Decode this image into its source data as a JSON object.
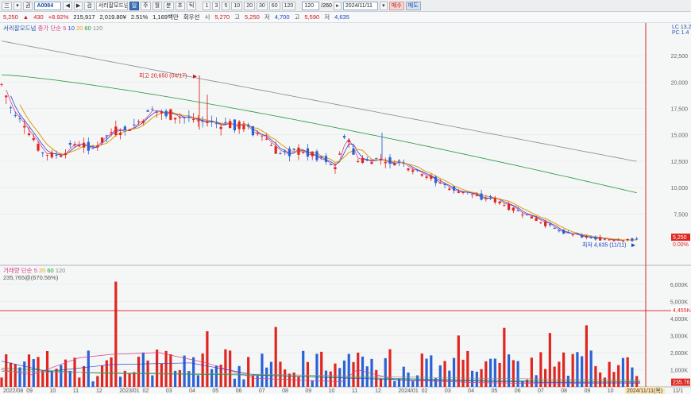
{
  "toolbar": {
    "buttons_left": [
      "三",
      "▾",
      "권",
      "◀",
      "▶",
      "검"
    ],
    "code_value": "A0084",
    "stock_name": "서리잘모드넘",
    "buttons_mid": [
      "일",
      "주",
      "월",
      "분",
      "초",
      "틱"
    ],
    "periods": [
      "1",
      "3",
      "5",
      "10",
      "20",
      "30",
      "60",
      "120"
    ],
    "range_value": "120",
    "range_total": "/260",
    "date_value": "2024/11/11",
    "buy_label": "매수",
    "sell_label": "매도"
  },
  "infobar": {
    "price": "5,250",
    "change_arrow": "▲",
    "change": "430",
    "change_pct": "+8.92%",
    "volume": "215,917",
    "amount": "2,019.80¥",
    "turnover": "2.51%",
    "cap": "1,169백만",
    "kind": "회우선",
    "open_label": "시",
    "open": "5,270",
    "high_label": "고",
    "high": "5,250",
    "low_label": "저",
    "low": "4,700",
    "high2_label": "고",
    "high2": "5,590",
    "low2_label": "저",
    "low2": "4,635"
  },
  "legend_price": {
    "title": "서리잘모드넘",
    "label": "종가 단순",
    "ma": [
      "5",
      "10",
      "20",
      "60",
      "120"
    ]
  },
  "legend_volume": {
    "title": "거래량 단순",
    "ma": [
      "5",
      "20",
      "60",
      "120"
    ],
    "value": "235,765@(670.56%)"
  },
  "annotations": {
    "high_marker": "최고 20,650 (04/17)",
    "low_marker": "최저 4,635 (11/11)"
  },
  "colors": {
    "up": "#e0251f",
    "down": "#2a62d6",
    "ma5": "#d6408a",
    "ma10": "#2a45c9",
    "ma20": "#e3a11a",
    "ma60": "#1f9a3a",
    "ma120": "#8a8a8a",
    "crosshair": "#d11a1a"
  },
  "price_axis": {
    "ticks": [
      "22,500",
      "20,000",
      "17,500",
      "15,000",
      "12,500",
      "10,000",
      "7,500"
    ],
    "current_tag": "5,250",
    "current_pct": "0.00%",
    "top_tags": [
      "LC 13.2",
      "PC 1.4"
    ]
  },
  "volume_axis": {
    "ticks": [
      "6,000K",
      "5,000K",
      "4,000K",
      "3,000K",
      "2,000K",
      "1,000K"
    ],
    "cursor_tag": "4,455K",
    "current_tag": "235.76"
  },
  "x_axis": {
    "labels": [
      "2022/08",
      "09",
      "10",
      "11",
      "12",
      "2023/01",
      "02",
      "03",
      "04",
      "05",
      "06",
      "07",
      "08",
      "09",
      "10",
      "11",
      "12",
      "2024/01",
      "02",
      "03",
      "04",
      "05",
      "06",
      "07",
      "08",
      "09",
      "10",
      "11"
    ],
    "cursor_label": "2024/11/11(목)",
    "right_label": "11/1"
  },
  "chart_data": {
    "type": "candlestick",
    "ma_periods": [
      5,
      10,
      20,
      60,
      120
    ],
    "price_range": [
      3000,
      25000
    ],
    "volume_range": [
      0,
      6500
    ],
    "volume_unit": "K",
    "notable": {
      "high": 20650,
      "high_date": "04/17",
      "low": 4635,
      "low_date": "11/11",
      "last_close": 5250
    },
    "cursor": {
      "date": "2024/11/11",
      "volume_level_k": 4455
    }
  }
}
